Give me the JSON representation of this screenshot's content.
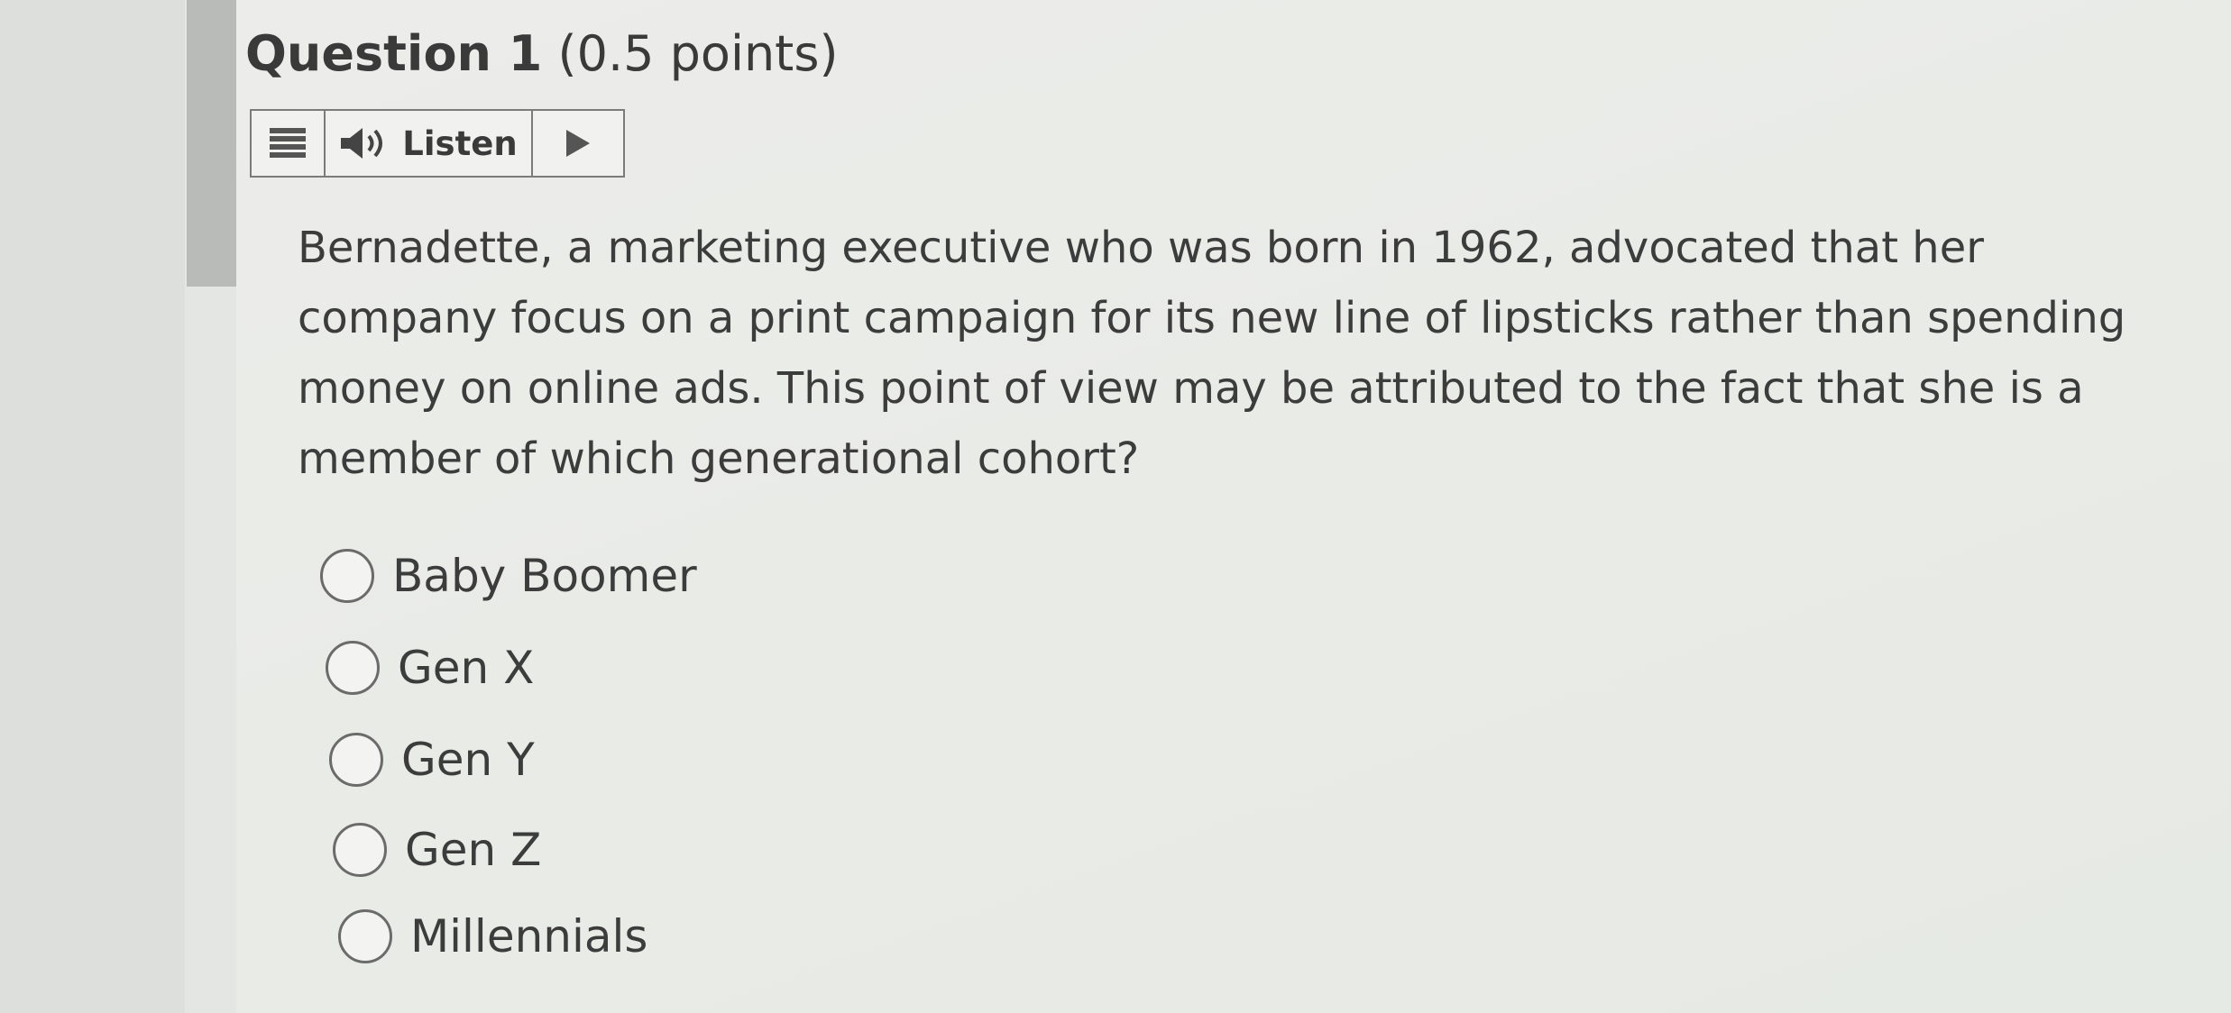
{
  "question": {
    "number_label": "Question 1",
    "points_label": "(0.5 points)",
    "lines": [
      "Bernadette, a marketing executive who was born in 1962, advocated that her",
      "company focus on a print campaign for its new line of lipsticks rather than spending",
      "money on online ads. This point of view may be attributed to the fact that she is a",
      "member of which generational cohort?"
    ]
  },
  "listen_toolbar": {
    "menu_icon": "menu-icon",
    "speaker_icon": "speaker-icon",
    "listen_label": "Listen",
    "play_icon": "play-icon"
  },
  "options": [
    {
      "label": "Baby Boomer",
      "selected": false
    },
    {
      "label": "Gen X",
      "selected": false
    },
    {
      "label": "Gen Y",
      "selected": false
    },
    {
      "label": "Gen Z",
      "selected": false
    },
    {
      "label": "Millennials",
      "selected": false
    }
  ],
  "colors": {
    "text": "#3c3c3c",
    "accent_bar": "#b9bbb8",
    "border": "#7a7c7a"
  }
}
